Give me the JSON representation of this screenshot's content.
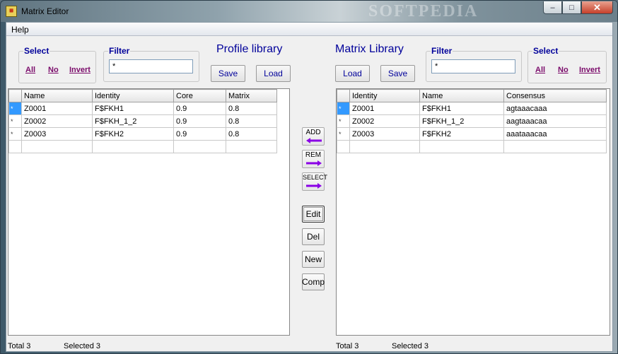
{
  "window": {
    "title": "Matrix Editor",
    "watermark": "SOFTPEDIA",
    "controls": {
      "minimize": "–",
      "maximize": "□",
      "close": "✕"
    }
  },
  "menu": {
    "items": [
      "Help"
    ]
  },
  "left": {
    "select": {
      "label": "Select",
      "all": "All",
      "no": "No",
      "invert": "Invert"
    },
    "filter": {
      "label": "Filter",
      "value": "*"
    },
    "title": "Profile library",
    "save_label": "Save",
    "load_label": "Load",
    "columns": [
      "Name",
      "Identity",
      "Core",
      "Matrix"
    ],
    "rows": [
      {
        "indicator": "*",
        "name": "Z0001",
        "identity": "F$FKH1",
        "core": "0.9",
        "matrix": "0.8"
      },
      {
        "indicator": "*",
        "name": "Z0002",
        "identity": "F$FKH_1_2",
        "core": "0.9",
        "matrix": "0.8"
      },
      {
        "indicator": "*",
        "name": "Z0003",
        "identity": "F$FKH2",
        "core": "0.9",
        "matrix": "0.8"
      }
    ],
    "status": {
      "total": "Total  3",
      "selected": "Selected  3"
    }
  },
  "center": {
    "add": "ADD",
    "rem": "REM",
    "select": "SELECT",
    "edit": "Edit",
    "del": "Del",
    "new": "New",
    "comp": "Comp"
  },
  "right": {
    "select": {
      "label": "Select",
      "all": "All",
      "no": "No",
      "invert": "Invert"
    },
    "filter": {
      "label": "Filter",
      "value": "*"
    },
    "title": "Matrix Library",
    "save_label": "Save",
    "load_label": "Load",
    "columns": [
      "Identity",
      "Name",
      "Consensus"
    ],
    "rows": [
      {
        "indicator": "*",
        "identity": "Z0001",
        "name": "F$FKH1",
        "consensus": "agtaaacaaa"
      },
      {
        "indicator": "*",
        "identity": "Z0002",
        "name": "F$FKH_1_2",
        "consensus": "aagtaaacaa"
      },
      {
        "indicator": "*",
        "identity": "Z0003",
        "name": "F$FKH2",
        "consensus": "aaataaacaa"
      }
    ],
    "status": {
      "total": "Total  3",
      "selected": "Selected  3"
    }
  },
  "colors": {
    "label_blue": "#00009a",
    "link_purple": "#7a0a6a",
    "arrow_purple": "#8a00e6",
    "selection_blue": "#3399ff"
  }
}
